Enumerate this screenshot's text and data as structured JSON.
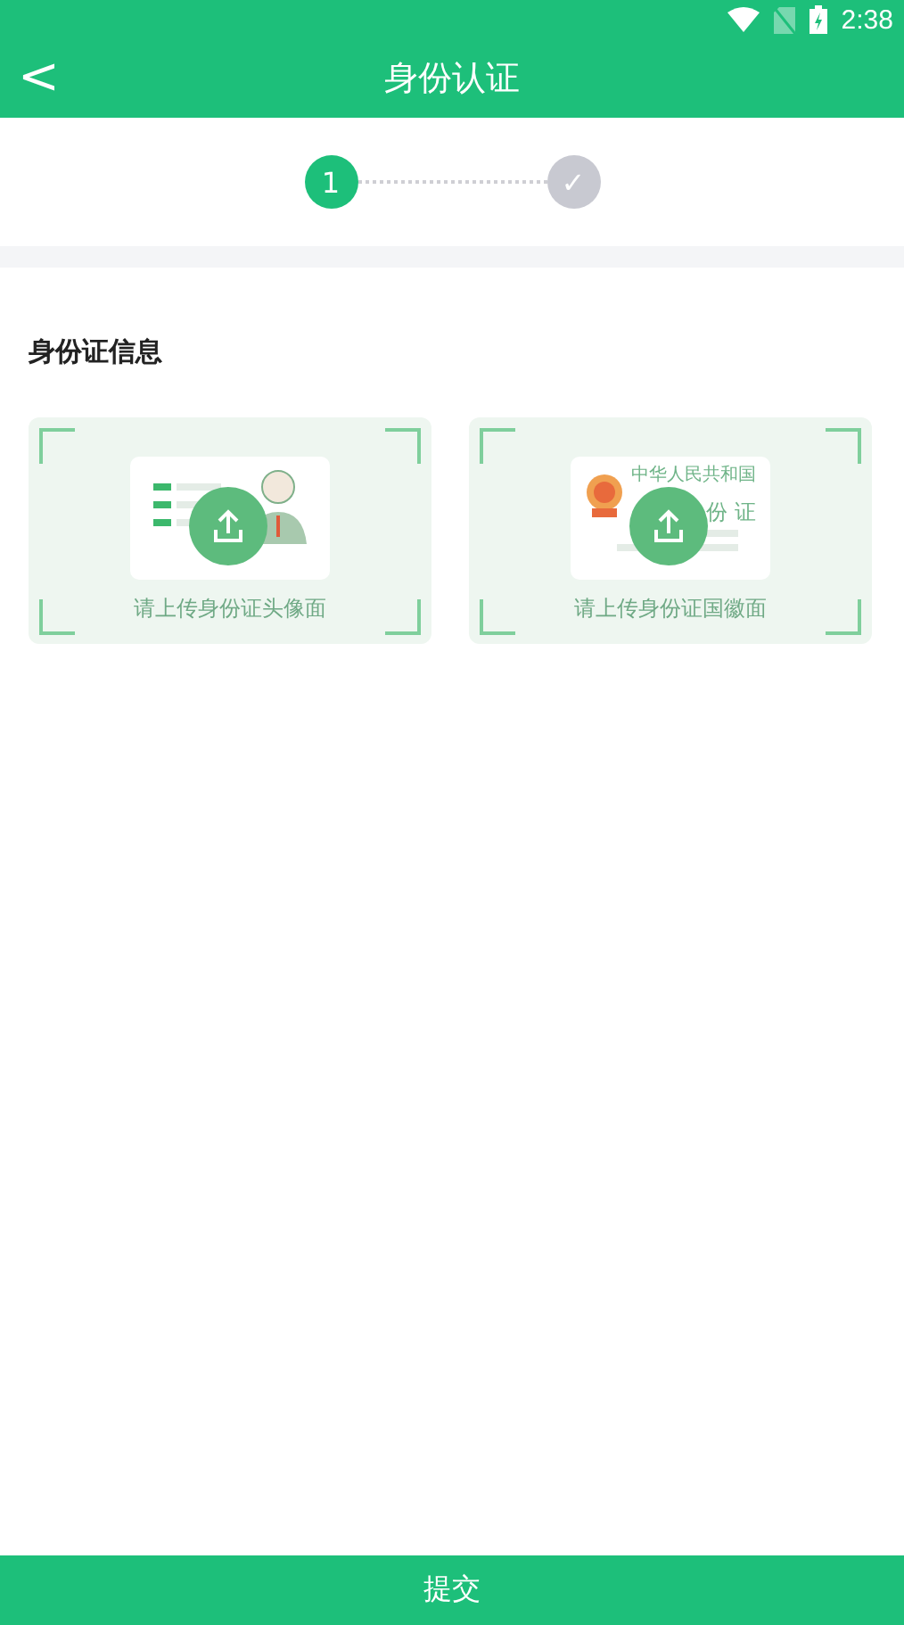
{
  "status_bar": {
    "time": "2:38"
  },
  "header": {
    "back": "<",
    "title": "身份认证"
  },
  "steps": [
    {
      "label": "1",
      "selected": true
    },
    {
      "label": "✓",
      "selected": false
    }
  ],
  "section": {
    "title": "身份证信息"
  },
  "uploads": [
    {
      "kind": "portrait",
      "caption": "请上传身份证头像面"
    },
    {
      "kind": "emblem",
      "caption": "请上传身份证国徽面",
      "card_texts": [
        "中华人民共和国",
        "份 证"
      ]
    }
  ],
  "submit": {
    "label": "提交"
  }
}
